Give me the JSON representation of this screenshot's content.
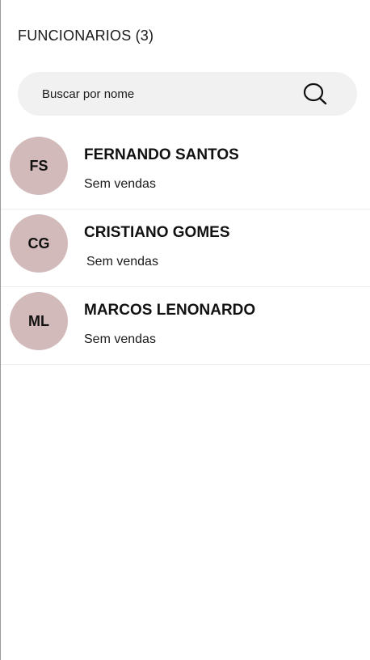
{
  "header": {
    "title": "FUNCIONARIOS (3)"
  },
  "search": {
    "placeholder": "Buscar por nome",
    "value": "",
    "icon": "search-icon"
  },
  "employees": [
    {
      "initials": "FS",
      "name": "FERNANDO SANTOS",
      "status": "Sem vendas"
    },
    {
      "initials": "CG",
      "name": "CRISTIANO GOMES",
      "status": "Sem vendas"
    },
    {
      "initials": "ML",
      "name": "MARCOS LENONARDO",
      "status": "Sem vendas"
    }
  ],
  "colors": {
    "avatar_bg": "#d2b9ba",
    "search_bg": "#f1f1f1"
  }
}
